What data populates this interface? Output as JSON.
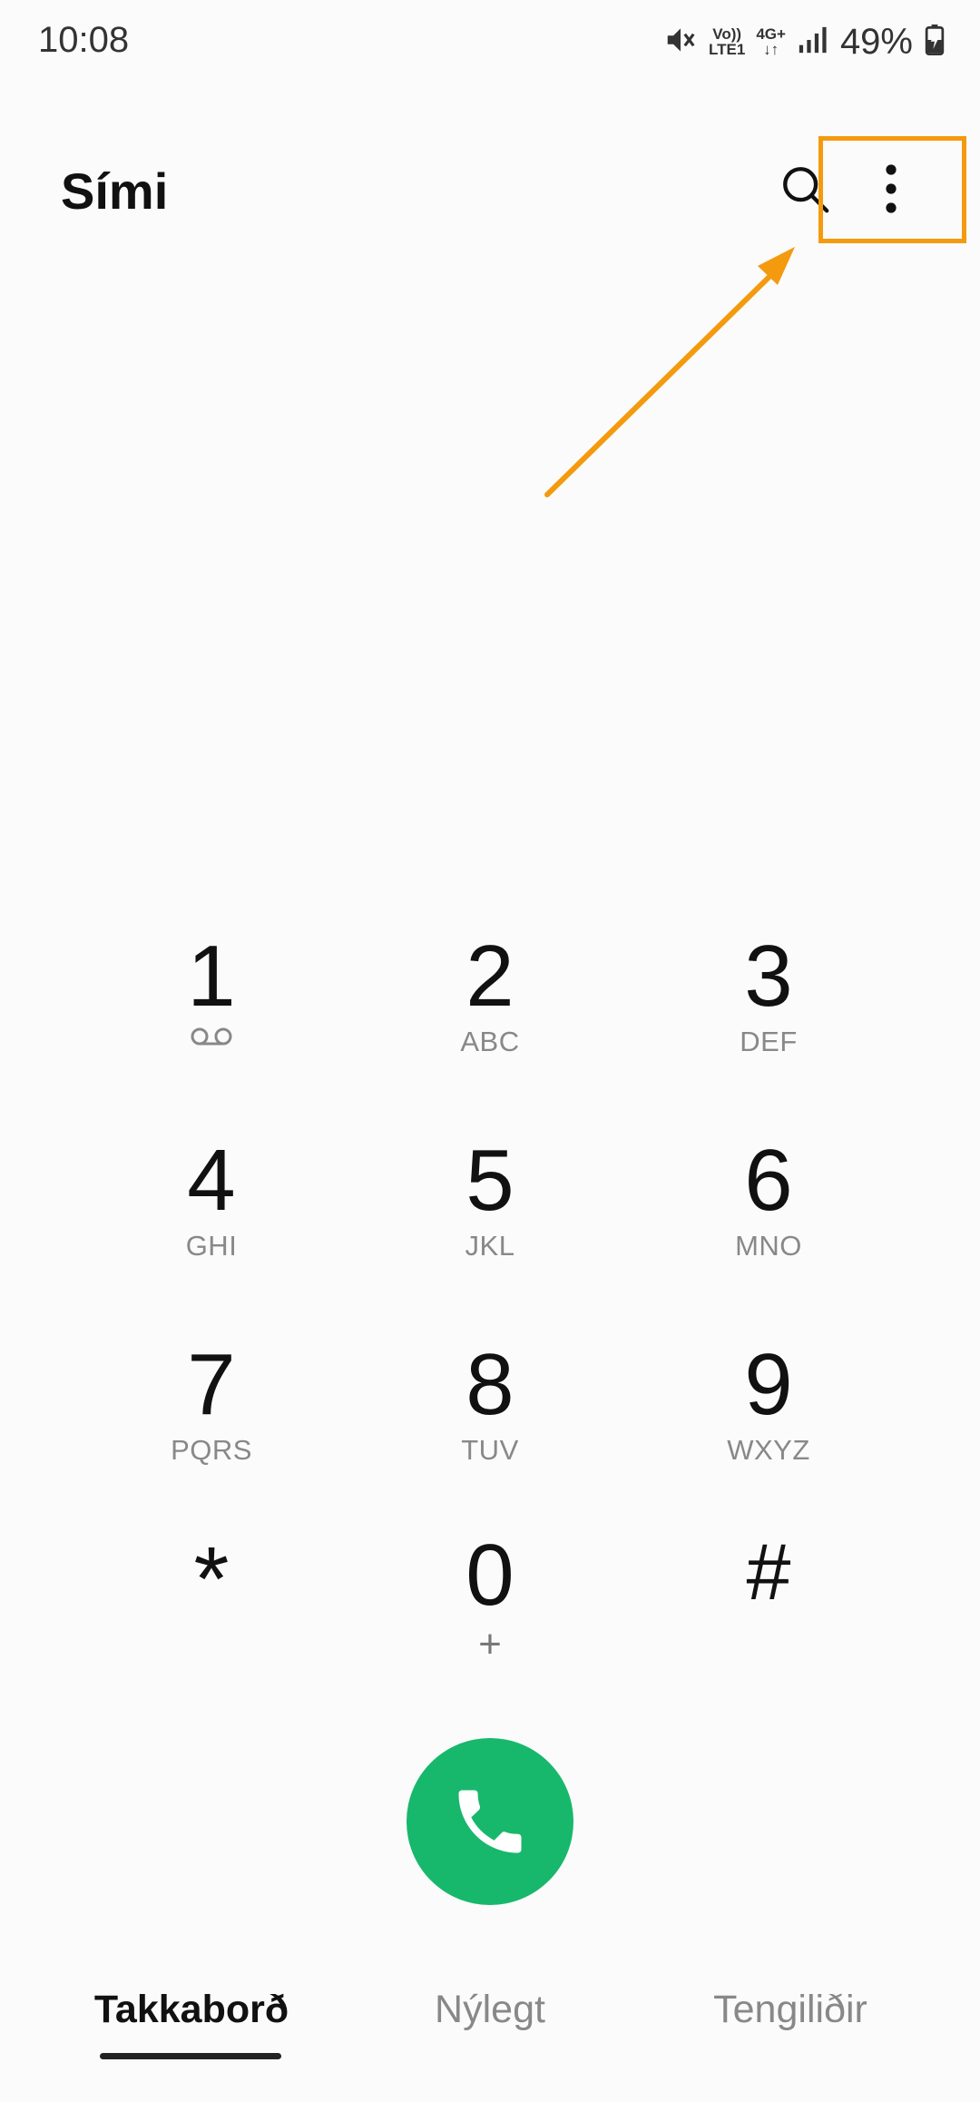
{
  "status_bar": {
    "time": "10:08",
    "network_top": "Vo))",
    "network_bottom": "LTE1",
    "network_type": "4G+",
    "battery": "49%",
    "icons": [
      "mute-icon",
      "signal-icon",
      "battery-charging-icon"
    ]
  },
  "header": {
    "title": "Sími",
    "search_icon": "search-icon",
    "more_icon": "more-vertical-icon"
  },
  "annotation": {
    "color": "#f49a0e"
  },
  "keypad": {
    "keys": [
      {
        "digit": "1",
        "letters": ""
      },
      {
        "digit": "2",
        "letters": "ABC"
      },
      {
        "digit": "3",
        "letters": "DEF"
      },
      {
        "digit": "4",
        "letters": "GHI"
      },
      {
        "digit": "5",
        "letters": "JKL"
      },
      {
        "digit": "6",
        "letters": "MNO"
      },
      {
        "digit": "7",
        "letters": "PQRS"
      },
      {
        "digit": "8",
        "letters": "TUV"
      },
      {
        "digit": "9",
        "letters": "WXYZ"
      },
      {
        "digit": "*",
        "letters": ""
      },
      {
        "digit": "0",
        "letters": "+"
      },
      {
        "digit": "#",
        "letters": ""
      }
    ]
  },
  "call_button": {
    "color": "#17b86b",
    "icon": "phone-icon"
  },
  "tabs": [
    {
      "label": "Takkaborð",
      "active": true
    },
    {
      "label": "Nýlegt",
      "active": false
    },
    {
      "label": "Tengiliðir",
      "active": false
    }
  ]
}
